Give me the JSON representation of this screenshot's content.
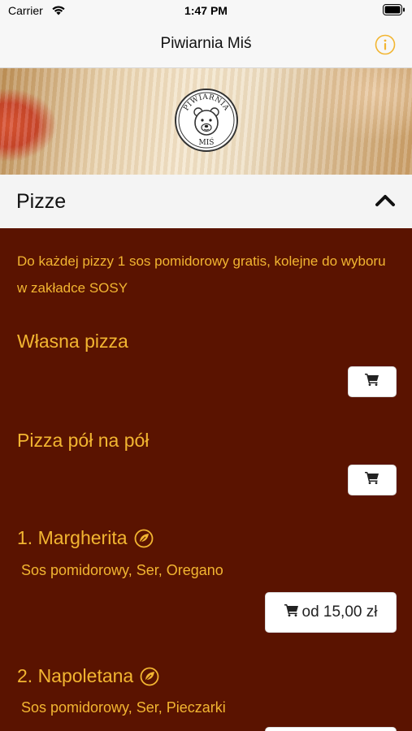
{
  "status_bar": {
    "carrier": "Carrier",
    "time": "1:47 PM"
  },
  "nav": {
    "title": "Piwiarnia Miś",
    "info_icon": "info-icon"
  },
  "banner": {
    "logo_top_text": "PIWIARNIA",
    "logo_bottom_text": "MIŚ"
  },
  "section": {
    "label": "Pizze",
    "expanded": true
  },
  "notice": "Do każdej pizzy 1 sos pomidorowy gratis, kolejne do wyboru w zakładce SOSY",
  "items": [
    {
      "title": "Własna pizza",
      "vegetarian": false,
      "description": "",
      "price": ""
    },
    {
      "title": "Pizza pół na pół",
      "vegetarian": false,
      "description": "",
      "price": ""
    },
    {
      "title": "1. Margherita",
      "vegetarian": true,
      "description": "Sos pomidorowy, Ser, Oregano",
      "price": "od 15,00 zł"
    },
    {
      "title": "2. Napoletana",
      "vegetarian": true,
      "description": "Sos pomidorowy, Ser, Pieczarki",
      "price": ""
    }
  ],
  "colors": {
    "accent": "#f2b531",
    "background": "#5a1300",
    "header": "#f4f4f4"
  }
}
